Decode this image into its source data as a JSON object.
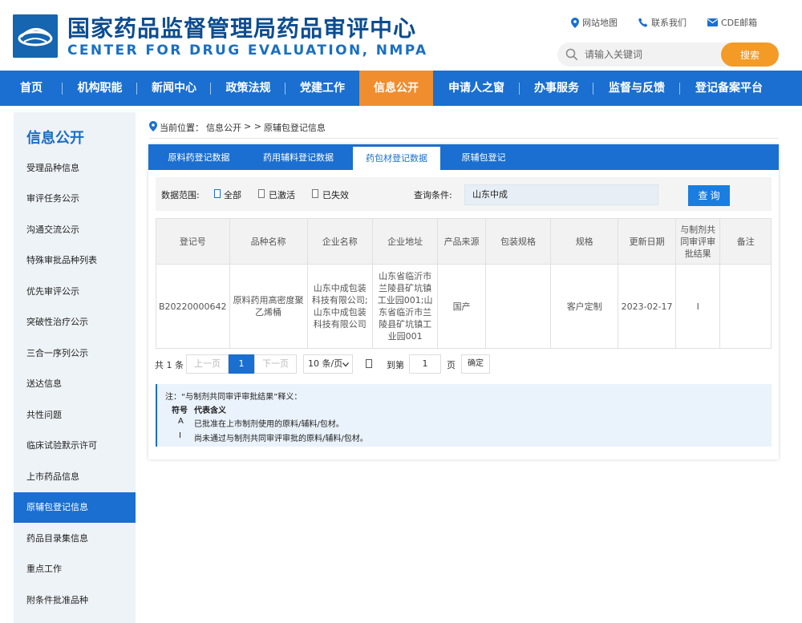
{
  "header": {
    "title_cn": "国家药品监督管理局药品审评中心",
    "title_en": "CENTER FOR DRUG EVALUATION, NMPA",
    "links": [
      {
        "label": "网站地图",
        "icon": "map-pin-icon"
      },
      {
        "label": "联系我们",
        "icon": "phone-icon"
      },
      {
        "label": "CDE邮箱",
        "icon": "mail-icon"
      }
    ],
    "search_placeholder": "请输入关键词",
    "search_button": "搜索"
  },
  "nav": {
    "items": [
      "首页",
      "机构职能",
      "新闻中心",
      "政策法规",
      "党建工作",
      "信息公开",
      "申请人之窗",
      "办事服务",
      "监督与反馈",
      "登记备案平台"
    ],
    "active_index": 5
  },
  "sidebar": {
    "title": "信息公开",
    "items": [
      "受理品种信息",
      "审评任务公示",
      "沟通交流公示",
      "特殊审批品种列表",
      "优先审评公示",
      "突破性治疗公示",
      "三合一序列公示",
      "送达信息",
      "共性问题",
      "临床试验默示许可",
      "上市药品信息",
      "原辅包登记信息",
      "药品目录集信息",
      "重点工作",
      "附条件批准品种"
    ],
    "active_index": 11
  },
  "breadcrumb": {
    "prefix": "当前位置：",
    "path": "信息公开",
    "separator": "> >",
    "current": "原辅包登记信息"
  },
  "tabs": {
    "items": [
      "原料药登记数据",
      "药用辅料登记数据",
      "药包材登记数据",
      "原辅包登记"
    ],
    "active_index": 2
  },
  "filter": {
    "scope_label": "数据范围:",
    "options": [
      "全部",
      "已激活",
      "已失效"
    ],
    "query_label": "查询条件:",
    "query_value": "山东中成",
    "query_button": "查 询"
  },
  "table": {
    "headers": [
      "登记号",
      "品种名称",
      "企业名称",
      "企业地址",
      "产品来源",
      "包装规格",
      "规格",
      "更新日期",
      "与制剂共同审评审批结果",
      "备注"
    ],
    "rows": [
      [
        "B20220000642",
        "原料药用高密度聚乙烯桶",
        "山东中成包装科技有限公司;山东中成包装科技有限公司",
        "山东省临沂市兰陵县矿坑镇工业园001;山东省临沂市兰陵县矿坑镇工业园001",
        "国产",
        "",
        "客户定制",
        "2023-02-17",
        "I",
        ""
      ]
    ]
  },
  "pager": {
    "total": "共 1 条",
    "prev": "上一页",
    "current": "1",
    "next": "下一页",
    "page_size": "10 条/页",
    "goto_label": "到第",
    "goto_value": "1",
    "page_unit": "页",
    "confirm": "确定"
  },
  "note": {
    "title": "注：“与制剂共同审评审批结果”释义：",
    "head_symbol": "符号",
    "head_meaning": "代表含义",
    "rows": [
      {
        "symbol": "A",
        "meaning": "已批准在上市制剂使用的原料/辅料/包材。"
      },
      {
        "symbol": "I",
        "meaning": "尚未通过与制剂共同审评审批的原料/辅料/包材。"
      }
    ]
  },
  "colors": {
    "primary_blue": "#1a6fd0",
    "accent_orange": "#f08d2e",
    "title_blue": "#0d4c8f"
  }
}
